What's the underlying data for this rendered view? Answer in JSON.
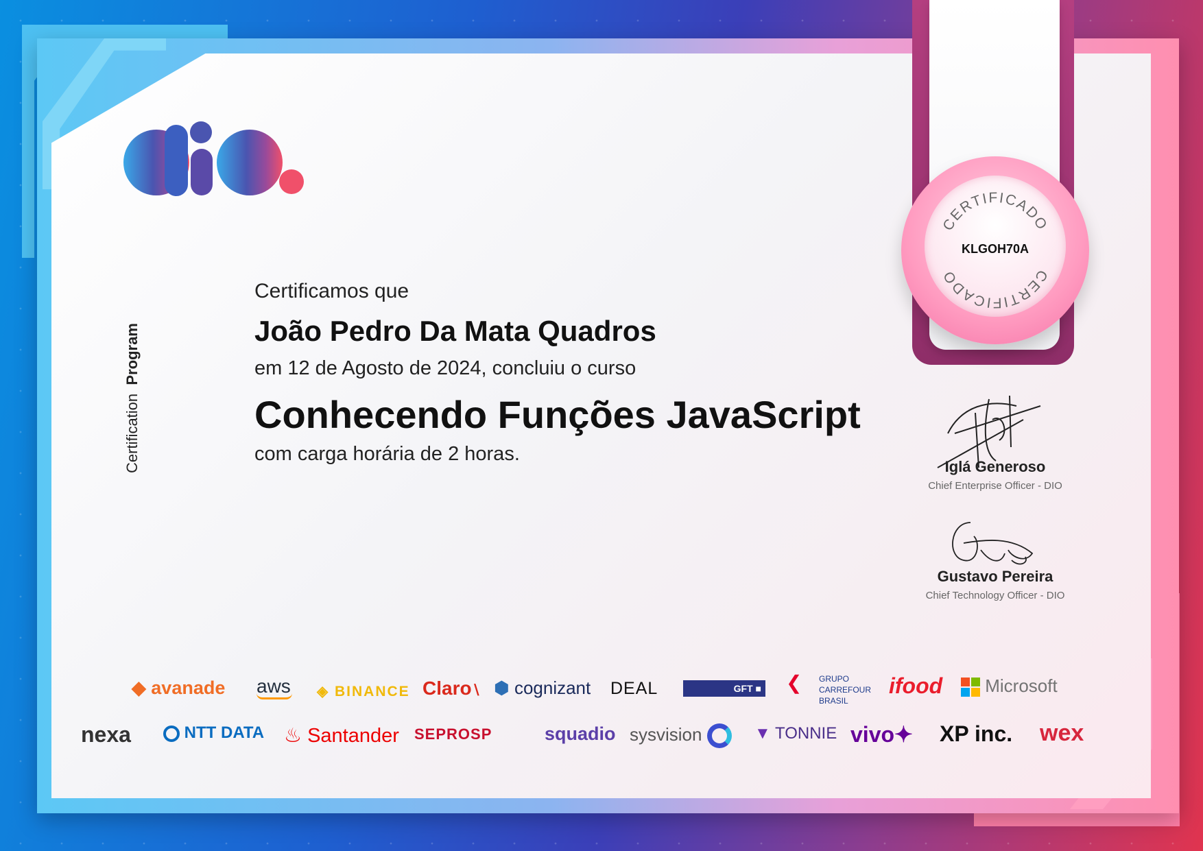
{
  "certificate": {
    "intro": "Certificamos que",
    "recipient_name": "João Pedro Da Mata Quadros",
    "date_line": "em 12 de Agosto de 2024, concluiu o curso",
    "course_name": "Conhecendo Funções JavaScript",
    "hours_line": "com carga horária de 2 horas.",
    "vertical_label_regular": "Certification",
    "vertical_label_bold": "Program"
  },
  "seal": {
    "top_text": "CERTIFICADO",
    "bottom_text": "CERTIFICADO",
    "code": "KLGOH70A"
  },
  "signatures": [
    {
      "name": "Iglá Generoso",
      "role": "Chief Enterprise Officer - DIO"
    },
    {
      "name": "Gustavo Pereira",
      "role": "Chief Technology Officer - DIO"
    }
  ],
  "partners_row1": {
    "avanade": "avanade",
    "aws": "aws",
    "binance": "BINANCE",
    "claro": "Claro",
    "cognizant": "cognizant",
    "deal": "DEAL",
    "gft": "GFT",
    "carrefour_1": "GRUPO",
    "carrefour_2": "CARREFOUR",
    "carrefour_3": "BRASIL",
    "ifood": "ifood",
    "microsoft": "Microsoft"
  },
  "partners_row2": {
    "nexa": "nexa",
    "nttdata": "NTT DATA",
    "santander": "Santander",
    "seprosp": "SEPROSP",
    "squadio": "squadio",
    "sysvision": "sysvision",
    "tonnie": "TONNIE",
    "vivo": "vivo",
    "xp": "XP inc.",
    "wex": "wex"
  },
  "colors": {
    "microsoft_red": "#f25022",
    "microsoft_green": "#7fba00",
    "microsoft_blue": "#00a4ef",
    "microsoft_yellow": "#ffb900",
    "santander_red": "#ec0000",
    "ifood_red": "#ea1d2c",
    "avanade_orange": "#f06d26",
    "gft_navy": "#2b3585",
    "wex_red": "#d7263d"
  }
}
